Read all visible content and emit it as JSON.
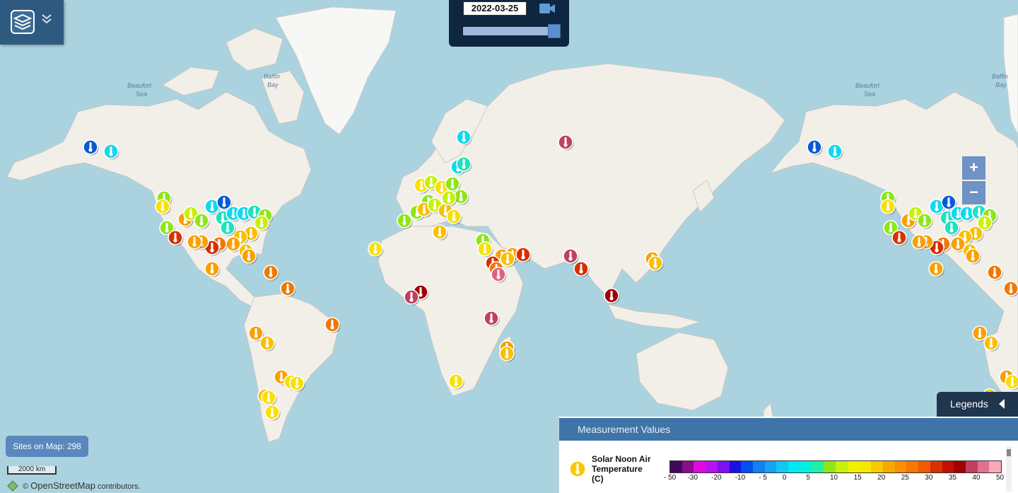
{
  "time_control": {
    "date": "2022-03-25",
    "position": 1.0
  },
  "labels": {
    "beaufort_1": "Beaufort",
    "beaufort_2": "Sea",
    "baffin_1": "Baffin",
    "baffin_2": "Bay"
  },
  "zoom": {
    "in": "+",
    "out": "−"
  },
  "sites": "Sites on Map: 298",
  "scale": "2000 km",
  "attribution": {
    "symbol": "©",
    "osm": "OpenStreetMap",
    "rest": "contributors."
  },
  "legend": {
    "tab_label": "Legends",
    "header": "Measurement Values",
    "variable_line1": "Solar Noon Air",
    "variable_line2": "Temperature",
    "variable_line3": "(C)",
    "colors": [
      "#3f0a57",
      "#8a0c8a",
      "#e00ae0",
      "#b512f0",
      "#7d12f0",
      "#1a10e8",
      "#0050f0",
      "#1380f0",
      "#17a3f0",
      "#10c8f0",
      "#00e8f0",
      "#00f0e0",
      "#20f0a0",
      "#8ee61a",
      "#c8f00a",
      "#f0f000",
      "#f8e800",
      "#f8c800",
      "#f8a800",
      "#f89000",
      "#f87800",
      "#f05a00",
      "#d83000",
      "#c01000",
      "#a00000",
      "#c04060",
      "#e07090",
      "#f8a8b8"
    ],
    "ticks": [
      "- 50",
      "-30",
      "-20",
      "-10",
      "- 5",
      "0",
      "5",
      "10",
      "15",
      "20",
      "25",
      "30",
      "35",
      "40",
      "50"
    ]
  },
  "sites_data": [
    {
      "temp": -5
    },
    {
      "temp": 5
    },
    {
      "temp": 2
    },
    {
      "temp": 22
    }
  ]
}
